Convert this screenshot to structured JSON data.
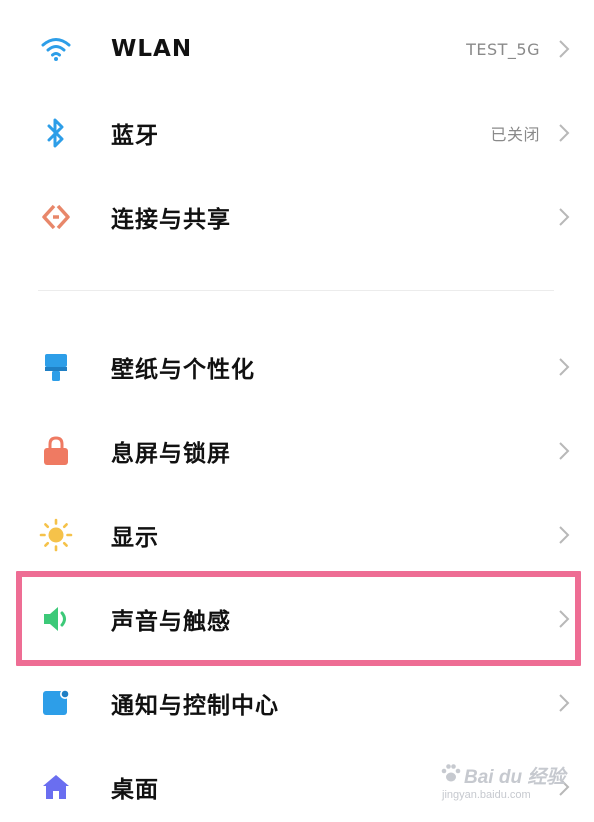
{
  "items": [
    {
      "label": "WLAN",
      "value": "TEST_5G",
      "icon": "wifi-icon",
      "color": "#2d9ee8"
    },
    {
      "label": "蓝牙",
      "value": "已关闭",
      "icon": "bluetooth-icon",
      "color": "#2d9ee8"
    },
    {
      "label": "连接与共享",
      "value": "",
      "icon": "share-icon",
      "color": "#e8876a"
    },
    {
      "label": "壁纸与个性化",
      "value": "",
      "icon": "brush-icon",
      "color": "#2d9ee8"
    },
    {
      "label": "息屏与锁屏",
      "value": "",
      "icon": "lock-icon",
      "color": "#ef7a62"
    },
    {
      "label": "显示",
      "value": "",
      "icon": "sun-icon",
      "color": "#f5c24a"
    },
    {
      "label": "声音与触感",
      "value": "",
      "icon": "speaker-icon",
      "color": "#3cc978"
    },
    {
      "label": "通知与控制中心",
      "value": "",
      "icon": "notification-icon",
      "color": "#2d9ee8"
    },
    {
      "label": "桌面",
      "value": "",
      "icon": "home-icon",
      "color": "#6a6ef0"
    }
  ],
  "highlight_color": "#ee6d94",
  "watermark": {
    "brand": "Bai du 经验",
    "url": "jingyan.baidu.com"
  }
}
